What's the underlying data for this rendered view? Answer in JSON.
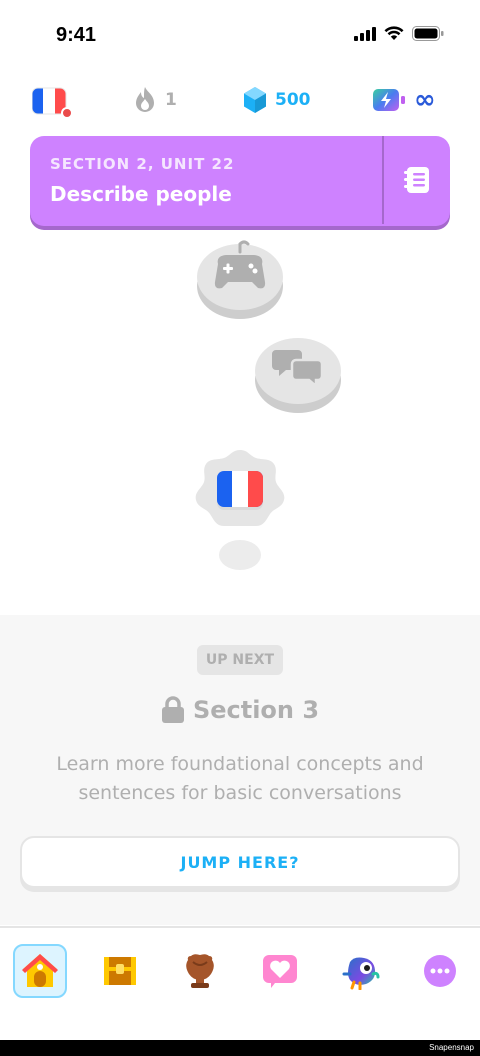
{
  "status_bar": {
    "time": "9:41"
  },
  "stats": {
    "streak": "1",
    "gems": "500",
    "energy": "∞"
  },
  "banner": {
    "section_label": "SECTION 2, UNIT 22",
    "title": "Describe people",
    "color": "#ce82ff"
  },
  "path": {
    "nodes": [
      {
        "icon": "gamepad-icon",
        "state": "locked"
      },
      {
        "icon": "chat-bubbles-icon",
        "state": "locked"
      },
      {
        "icon": "french-flag-icon",
        "state": "locked"
      }
    ]
  },
  "up_next": {
    "badge": "UP NEXT",
    "section_title": "Section 3",
    "description": "Learn more foundational concepts and sentences for basic conversations",
    "button_label": "JUMP HERE?"
  },
  "tabs": [
    {
      "icon": "home-icon",
      "active": true
    },
    {
      "icon": "treasure-chest-icon",
      "active": false
    },
    {
      "icon": "trophy-icon",
      "active": false
    },
    {
      "icon": "heart-icon",
      "active": false
    },
    {
      "icon": "owl-icon",
      "active": false
    },
    {
      "icon": "more-icon",
      "active": false
    }
  ],
  "watermark": "Snapensnap",
  "colors": {
    "accent_blue": "#1cb0f6",
    "locked_gray": "#afafaf",
    "purple": "#ce82ff"
  }
}
